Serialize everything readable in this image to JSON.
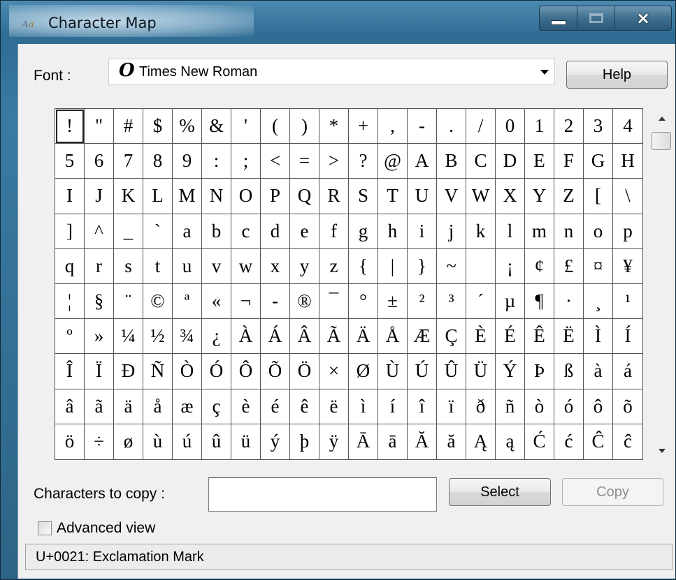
{
  "window": {
    "title": "Character Map",
    "icon": "character-map-app-icon",
    "controls": {
      "minimize": "minimize-icon",
      "maximize": "maximize-icon",
      "close": "×"
    }
  },
  "font": {
    "label": "Font :",
    "icon": "opentype-font-icon",
    "icon_glyph": "O",
    "selected": "Times New Roman"
  },
  "buttons": {
    "help": "Help",
    "select": "Select",
    "copy": "Copy"
  },
  "characters": [
    "!",
    "\"",
    "#",
    "$",
    "%",
    "&",
    "'",
    "(",
    ")",
    "*",
    "+",
    ",",
    "-",
    ".",
    "/",
    "0",
    "1",
    "2",
    "3",
    "4",
    "5",
    "6",
    "7",
    "8",
    "9",
    ":",
    ";",
    "<",
    "=",
    ">",
    "?",
    "@",
    "A",
    "B",
    "C",
    "D",
    "E",
    "F",
    "G",
    "H",
    "I",
    "J",
    "K",
    "L",
    "M",
    "N",
    "O",
    "P",
    "Q",
    "R",
    "S",
    "T",
    "U",
    "V",
    "W",
    "X",
    "Y",
    "Z",
    "[",
    "\\",
    "]",
    "^",
    "_",
    "`",
    "a",
    "b",
    "c",
    "d",
    "e",
    "f",
    "g",
    "h",
    "i",
    "j",
    "k",
    "l",
    "m",
    "n",
    "o",
    "p",
    "q",
    "r",
    "s",
    "t",
    "u",
    "v",
    "w",
    "x",
    "y",
    "z",
    "{",
    "|",
    "}",
    "~",
    " ",
    "¡",
    "¢",
    "£",
    "¤",
    "¥",
    "¦",
    "§",
    "¨",
    "©",
    "ª",
    "«",
    "¬",
    "-",
    "®",
    "¯",
    "°",
    "±",
    "²",
    "³",
    "´",
    "µ",
    "¶",
    "·",
    "¸",
    "¹",
    "º",
    "»",
    "¼",
    "½",
    "¾",
    "¿",
    "À",
    "Á",
    "Â",
    "Ã",
    "Ä",
    "Å",
    "Æ",
    "Ç",
    "È",
    "É",
    "Ê",
    "Ë",
    "Ì",
    "Í",
    "Î",
    "Ï",
    "Ð",
    "Ñ",
    "Ò",
    "Ó",
    "Ô",
    "Õ",
    "Ö",
    "×",
    "Ø",
    "Ù",
    "Ú",
    "Û",
    "Ü",
    "Ý",
    "Þ",
    "ß",
    "à",
    "á",
    "â",
    "ã",
    "ä",
    "å",
    "æ",
    "ç",
    "è",
    "é",
    "ê",
    "ë",
    "ì",
    "í",
    "î",
    "ï",
    "ð",
    "ñ",
    "ò",
    "ó",
    "ô",
    "õ",
    "ö",
    "÷",
    "ø",
    "ù",
    "ú",
    "û",
    "ü",
    "ý",
    "þ",
    "ÿ",
    "Ā",
    "ā",
    "Ă",
    "ă",
    "Ą",
    "ą",
    "Ć",
    "ć",
    "Ĉ",
    "ĉ"
  ],
  "selected_index": 0,
  "copy": {
    "label": "Characters to copy :",
    "value": ""
  },
  "advanced_view": {
    "label": "Advanced view",
    "checked": false
  },
  "status": {
    "text": "U+0021: Exclamation Mark"
  }
}
